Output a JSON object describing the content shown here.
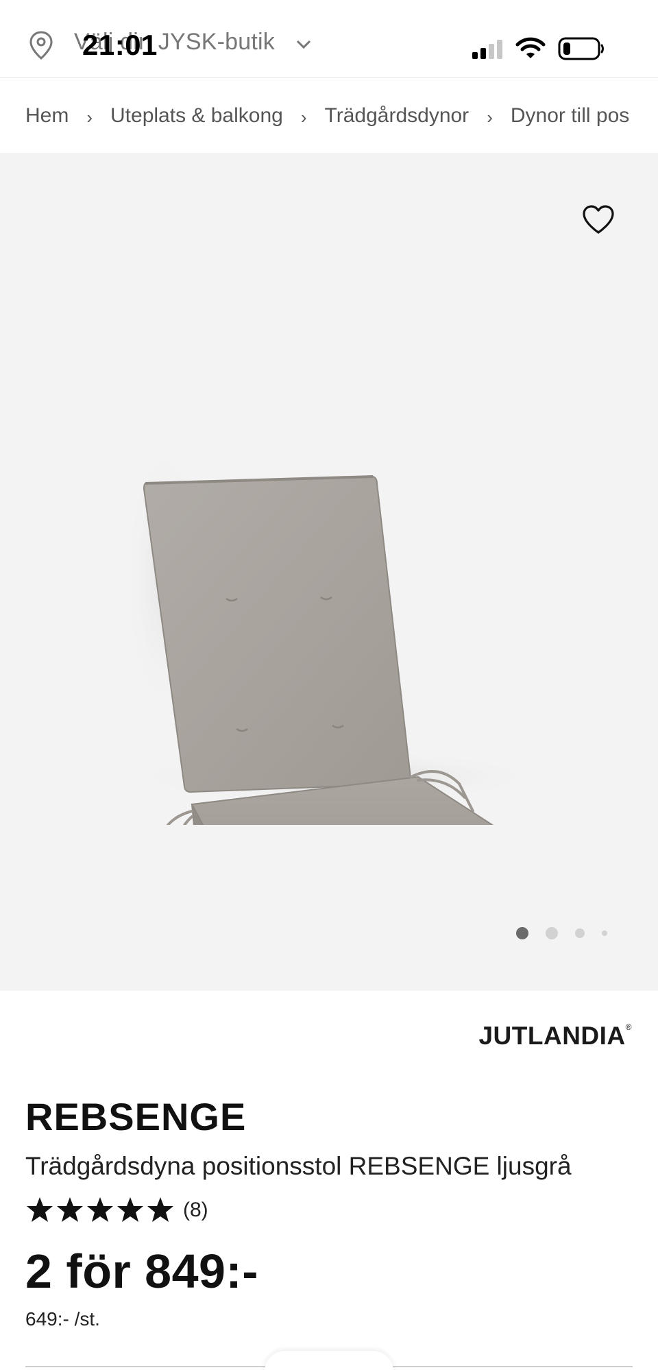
{
  "topbar": {
    "store_label": "Välj din JYSK-butik",
    "time": "21:01"
  },
  "breadcrumb": {
    "items": [
      "Hem",
      "Uteplats & balkong",
      "Trädgårdsdynor",
      "Dynor till pos"
    ],
    "separator": "›"
  },
  "gallery": {
    "image_count": 4,
    "active_index": 0
  },
  "product": {
    "brand": "JUTLANDIA",
    "brand_mark": "®",
    "name": "REBSENGE",
    "description": "Trädgårdsdyna positionsstol REBSENGE ljusgrå",
    "rating": 5,
    "rating_max": 5,
    "review_count": "(8)",
    "price": "2 för 849:-",
    "unit_price": "649:- /st."
  },
  "colors": {
    "gallery_bg": "#f3f3f3",
    "cushion": "#a8a29c",
    "text": "#111111",
    "muted": "#777777"
  }
}
